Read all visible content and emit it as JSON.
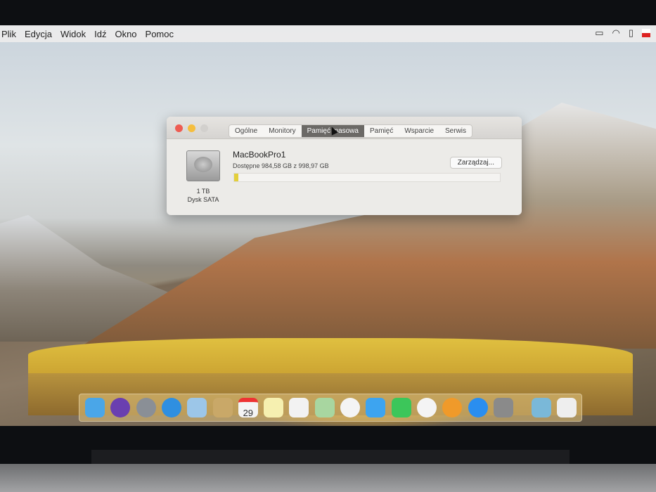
{
  "menubar": {
    "items": [
      "Plik",
      "Edycja",
      "Widok",
      "Idź",
      "Okno",
      "Pomoc"
    ],
    "status_icons": [
      "airplay-icon",
      "wifi-icon",
      "battery-icon",
      "flag-icon"
    ]
  },
  "window": {
    "tabs": [
      {
        "label": "Ogólne"
      },
      {
        "label": "Monitory"
      },
      {
        "label": "Pamięć masowa",
        "selected": true
      },
      {
        "label": "Pamięć"
      },
      {
        "label": "Wsparcie"
      },
      {
        "label": "Serwis"
      }
    ],
    "disk": {
      "name": "MacBookPro1",
      "available": "Dostępne 984,58 GB z 998,97 GB",
      "capacity": "1 TB",
      "type": "Dysk SATA",
      "used_fraction": 0.0144
    },
    "manage_label": "Zarządzaj..."
  },
  "dock": {
    "calendar_day": "29",
    "icons": [
      "finder",
      "siri",
      "launchpad",
      "safari",
      "mail",
      "notes-folder",
      "calendar",
      "notes",
      "reminders",
      "maps",
      "photos",
      "messages",
      "facetime",
      "itunes",
      "ibooks",
      "app-store",
      "system-preferences",
      "downloads",
      "trash"
    ]
  },
  "colors": {
    "accent": "#6b6966",
    "bar_fill": "#e3cf3b"
  }
}
